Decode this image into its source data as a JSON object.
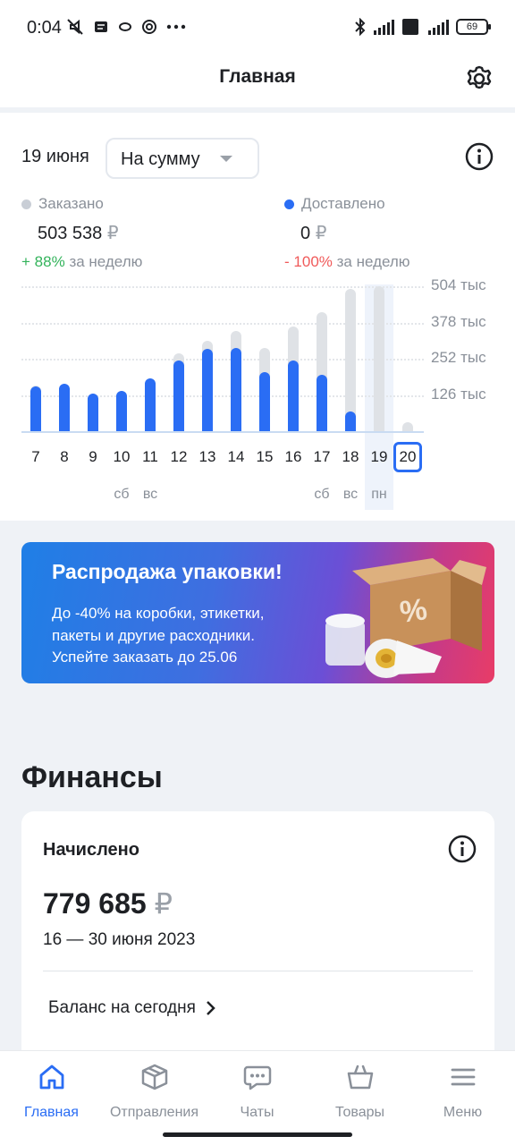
{
  "status_bar": {
    "time": "0:04",
    "battery": "69"
  },
  "header": {
    "title": "Главная"
  },
  "stats": {
    "date": "19 июня",
    "mode": "На сумму",
    "ordered": {
      "label": "Заказано",
      "value": "503 538",
      "currency": "₽",
      "change_sign": "+",
      "change_value": "88%",
      "change_period": "за неделю",
      "color": "#c9ced6"
    },
    "delivered": {
      "label": "Доставлено",
      "value": "0",
      "currency": "₽",
      "change_sign": "-",
      "change_value": "100%",
      "change_period": "за неделю",
      "color": "#2a6df4"
    }
  },
  "chart_data": {
    "type": "bar",
    "categories": [
      "7",
      "8",
      "9",
      "10",
      "11",
      "12",
      "13",
      "14",
      "15",
      "16",
      "17",
      "18",
      "19",
      "20"
    ],
    "weekday_labels": [
      "",
      "",
      "",
      "сб",
      "вс",
      "",
      "",
      "",
      "",
      "",
      "сб",
      "вс",
      "пн",
      ""
    ],
    "series": [
      {
        "values": [
          160000,
          160000,
          130000,
          140000,
          180000,
          270000,
          315000,
          350000,
          290000,
          365000,
          415000,
          495000,
          505000,
          30000
        ]
      },
      {
        "values": [
          155000,
          165000,
          130000,
          140000,
          185000,
          245000,
          285000,
          290000,
          205000,
          245000,
          195000,
          70000,
          0,
          0
        ]
      }
    ],
    "yticks": [
      "504 тыс",
      "378 тыс",
      "252 тыс",
      "126 тыс"
    ],
    "ytick_values": [
      504000,
      378000,
      252000,
      126000
    ],
    "ylim": [
      0,
      504000
    ],
    "highlighted_category": "19",
    "selected_category": "20",
    "colors": {
      "total": "#dfe2e6",
      "delivered": "#2a6df4"
    }
  },
  "promo": {
    "title": "Распродажа упаковки!",
    "line1": "До -40% на коробки, этикетки,",
    "line2": "пакеты и другие расходники.",
    "deadline": "Успейте заказать до 25.06"
  },
  "finance": {
    "title": "Финансы",
    "card_label": "Начислено",
    "amount": "779 685",
    "currency": "₽",
    "period": "16 — 30 июня 2023",
    "balance_link": "Баланс на сегодня"
  },
  "nav": {
    "items": [
      {
        "label": "Главная",
        "icon": "home-icon"
      },
      {
        "label": "Отправления",
        "icon": "box-icon"
      },
      {
        "label": "Чаты",
        "icon": "chat-icon"
      },
      {
        "label": "Товары",
        "icon": "basket-icon"
      },
      {
        "label": "Меню",
        "icon": "menu-icon"
      }
    ]
  }
}
